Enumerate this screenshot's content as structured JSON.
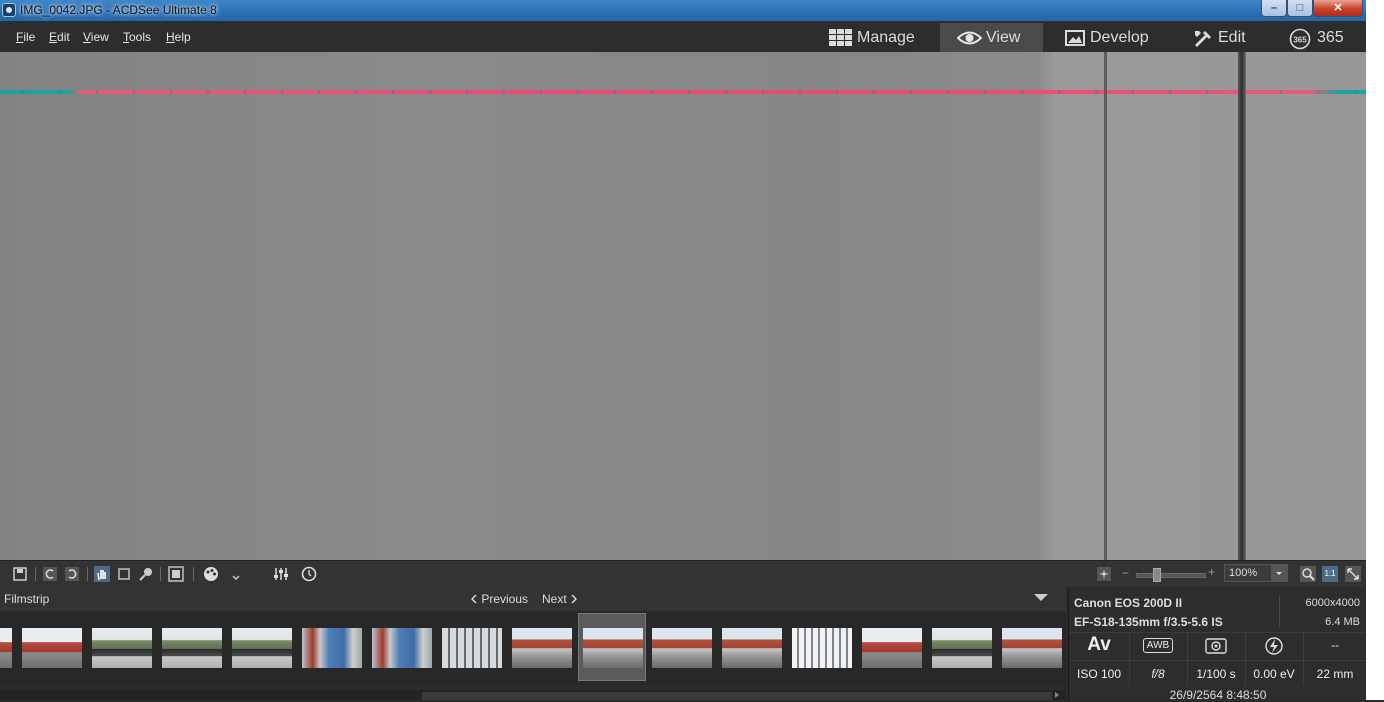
{
  "window": {
    "title": "IMG_0042.JPG - ACDSee Ultimate 8",
    "minimize": "–",
    "maximize": "□",
    "close": "✕"
  },
  "menu": [
    "File",
    "Edit",
    "View",
    "Tools",
    "Help"
  ],
  "modes": [
    {
      "label": "Manage",
      "icon": "grid-icon"
    },
    {
      "label": "View",
      "icon": "eye-icon",
      "active": true
    },
    {
      "label": "Develop",
      "icon": "image-icon"
    },
    {
      "label": "Edit",
      "icon": "brush-icon"
    },
    {
      "label": "365",
      "icon": "365-icon"
    }
  ],
  "toolbar": {
    "zoom": "100%",
    "zoom_minus": "−",
    "zoom_plus": "+",
    "one_to_one": "1:1"
  },
  "filmstrip": {
    "label": "Filmstrip",
    "previous": "Previous",
    "next": "Next",
    "thumbnails": [
      {
        "scene": "patio-red-wall"
      },
      {
        "scene": "tire-planters"
      },
      {
        "scene": "tire-planters"
      },
      {
        "scene": "tire-planters"
      },
      {
        "scene": "water-bottles"
      },
      {
        "scene": "water-bottles"
      },
      {
        "scene": "gate-wall"
      },
      {
        "scene": "houses-street"
      },
      {
        "scene": "houses-street",
        "selected": true
      },
      {
        "scene": "houses-street"
      },
      {
        "scene": "houses-street"
      },
      {
        "scene": "white-gate"
      },
      {
        "scene": "patio-red-wall"
      },
      {
        "scene": "tire-planters"
      },
      {
        "scene": "houses-street"
      }
    ]
  },
  "info": {
    "camera": "Canon EOS 200D II",
    "lens": "EF-S18-135mm f/3.5-5.6 IS",
    "dimensions": "6000x4000",
    "file_size": "6.4 MB",
    "mode": "Av",
    "white_balance": "AWB",
    "metering_icon": "metering-icon",
    "flash_icon": "flash-off-icon",
    "flash_value": "--",
    "iso": "ISO 100",
    "aperture": "f/8",
    "shutter": "1/100 s",
    "exposure": "0.00 eV",
    "focal": "22 mm",
    "date": "26/9/2564 8:48:50"
  },
  "colors": {
    "accent": "#2a6fb3",
    "panel": "#2d2d2d",
    "glitch": "#ec4a78"
  }
}
